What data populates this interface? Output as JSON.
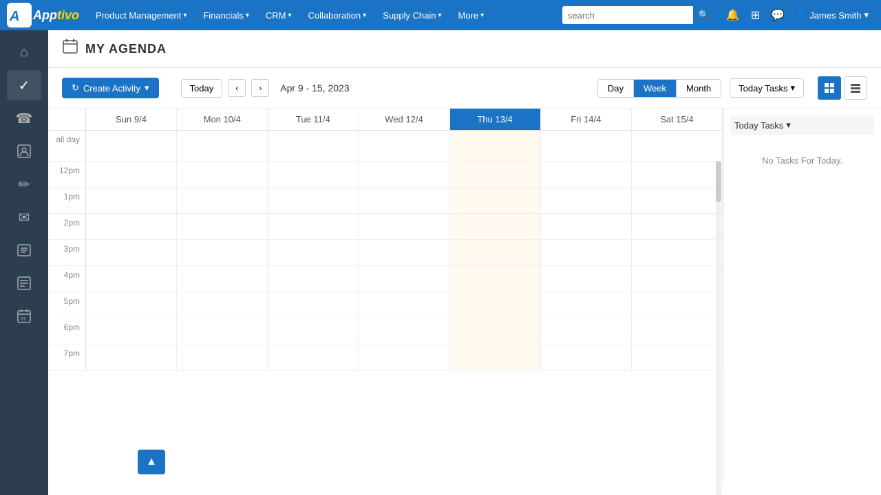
{
  "topnav": {
    "logo_app": "App",
    "logo_tivo": "tivo",
    "nav_items": [
      {
        "label": "Product Management",
        "id": "product-management"
      },
      {
        "label": "Financials",
        "id": "financials"
      },
      {
        "label": "CRM",
        "id": "crm"
      },
      {
        "label": "Collaboration",
        "id": "collaboration"
      },
      {
        "label": "Supply Chain",
        "id": "supply-chain"
      },
      {
        "label": "More",
        "id": "more"
      }
    ],
    "search_placeholder": "search",
    "user_name": "James Smith"
  },
  "sidebar": {
    "icons": [
      {
        "name": "home-icon",
        "glyph": "⌂"
      },
      {
        "name": "tasks-icon",
        "glyph": "✓"
      },
      {
        "name": "phone-icon",
        "glyph": "☎"
      },
      {
        "name": "contacts-icon",
        "glyph": "👤"
      },
      {
        "name": "tools-icon",
        "glyph": "✏"
      },
      {
        "name": "mail-icon",
        "glyph": "✉"
      },
      {
        "name": "list-icon",
        "glyph": "☰"
      },
      {
        "name": "report-icon",
        "glyph": "📋"
      },
      {
        "name": "calendar-icon",
        "glyph": "📅"
      }
    ]
  },
  "page": {
    "title": "MY AGENDA",
    "header_icon": "📋"
  },
  "toolbar": {
    "create_activity_label": "Create Activity",
    "today_label": "Today",
    "date_range": "Apr 9 - 15, 2023",
    "view_buttons": [
      "Day",
      "Week",
      "Month"
    ],
    "active_view": "Week",
    "today_tasks_label": "Today Tasks"
  },
  "calendar": {
    "allday_label": "all day",
    "columns": [
      {
        "label": "Sun 9/4",
        "is_today": false
      },
      {
        "label": "Mon 10/4",
        "is_today": false
      },
      {
        "label": "Tue 11/4",
        "is_today": false
      },
      {
        "label": "Wed 12/4",
        "is_today": false
      },
      {
        "label": "Thu 13/4",
        "is_today": true
      },
      {
        "label": "Fri 14/4",
        "is_today": false
      },
      {
        "label": "Sat 15/4",
        "is_today": false
      }
    ],
    "time_slots": [
      "12pm",
      "1pm",
      "2pm",
      "3pm",
      "4pm",
      "5pm",
      "6pm",
      "7pm"
    ]
  },
  "right_panel": {
    "header": "Today Tasks",
    "no_tasks": "No Tasks For Today."
  },
  "colors": {
    "primary": "#1a73c5",
    "today_bg": "#1a73c5",
    "today_col_bg": "#fff9f0"
  }
}
